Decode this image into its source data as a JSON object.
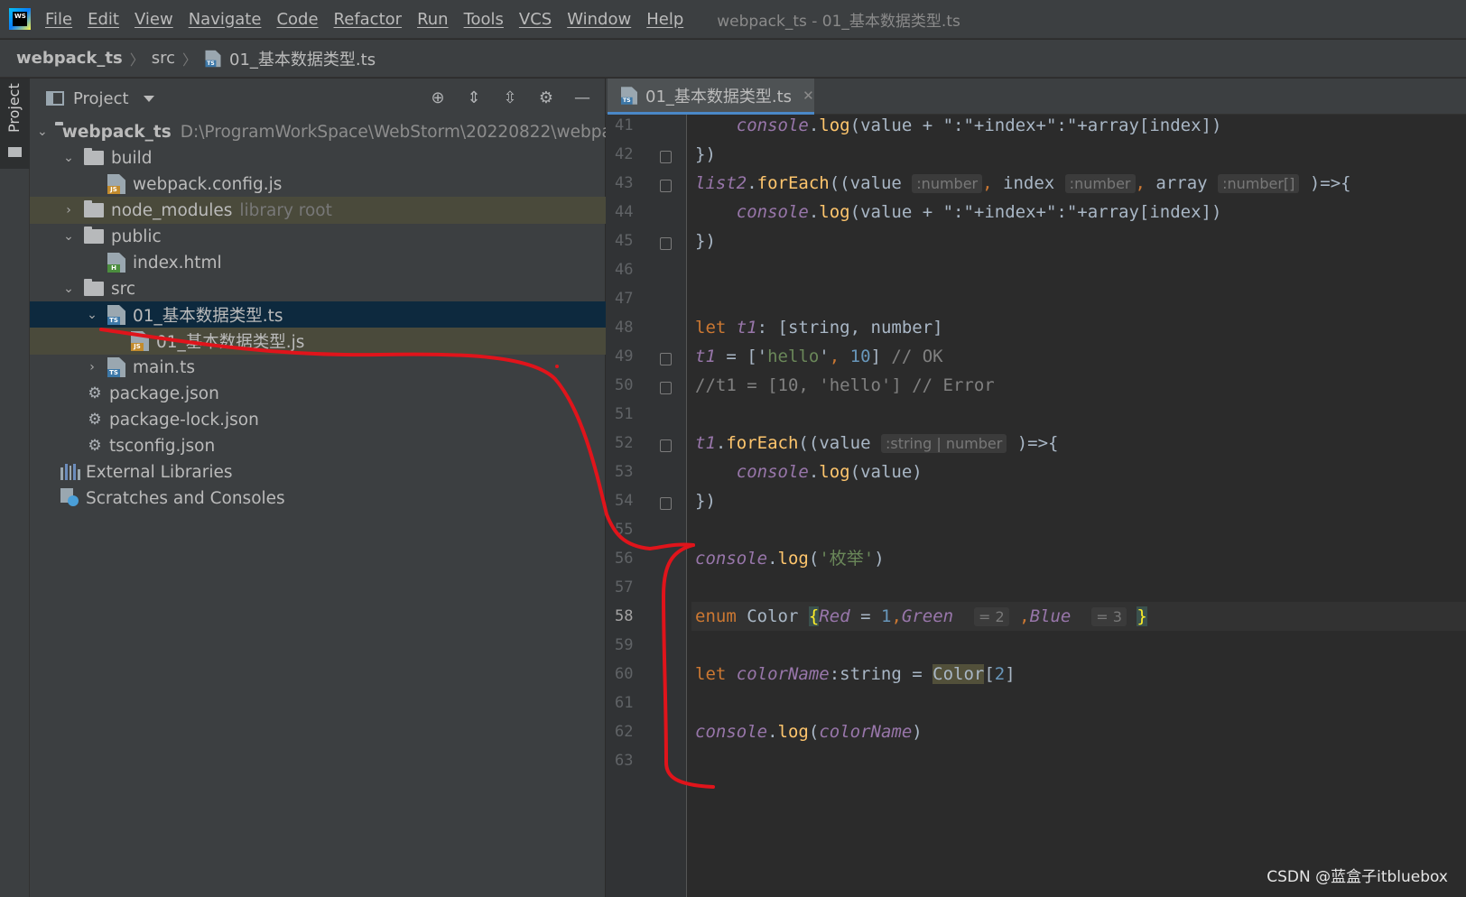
{
  "menubar": {
    "items": [
      "File",
      "Edit",
      "View",
      "Navigate",
      "Code",
      "Refactor",
      "Run",
      "Tools",
      "VCS",
      "Window",
      "Help"
    ],
    "window_title": "webpack_ts - 01_基本数据类型.ts"
  },
  "breadcrumb": {
    "project": "webpack_ts",
    "folder": "src",
    "file": "01_基本数据类型.ts"
  },
  "toolstrip": {
    "label": "Project"
  },
  "project_panel": {
    "title": "Project",
    "tree": {
      "root": "webpack_ts",
      "root_path": "D:\\ProgramWorkSpace\\WebStorm\\20220822\\webpac",
      "build": "build",
      "webpack_config": "webpack.config.js",
      "node_modules": "node_modules",
      "node_modules_note": "library root",
      "public": "public",
      "index_html": "index.html",
      "src": "src",
      "basic_ts": "01_基本数据类型.ts",
      "basic_js": "01_基本数据类型.js",
      "main_ts": "main.ts",
      "package_json": "package.json",
      "package_lock": "package-lock.json",
      "tsconfig": "tsconfig.json",
      "external_libraries": "External Libraries",
      "scratches": "Scratches and Consoles"
    }
  },
  "editor": {
    "tab_label": "01_基本数据类型.ts",
    "line_numbers": [
      "41",
      "42",
      "43",
      "44",
      "45",
      "46",
      "47",
      "48",
      "49",
      "50",
      "51",
      "52",
      "53",
      "54",
      "55",
      "56",
      "57",
      "58",
      "59",
      "60",
      "61",
      "62",
      "63"
    ],
    "current_line": "58",
    "tokens": {
      "console": "console",
      "log": "log",
      "forEach": "forEach",
      "list2": "list2",
      "value": "value",
      "index": "index",
      "array": "array",
      "index_expr": "(value + \":\"+index+\":\"+array[index])",
      "close_brace": "})",
      "hint_number": ":number",
      "hint_number_arr": ":number[]",
      "hint_string_number": ":string | number",
      "let": "let",
      "t1": "t1",
      "tuple_type": ": [string, number]",
      "t1_assign_open": " = ['",
      "hello": "hello",
      "ten": "10",
      "comment_ok": "// OK",
      "comment_error": "//t1 = [10, 'hello'] // Error",
      "log_value": "(value)",
      "enum_str": "枚举",
      "enum": "enum",
      "color_type": "Color",
      "red": "Red",
      "one": "1",
      "green": "Green",
      "hint_eq2": "= 2",
      "blue": "Blue",
      "hint_eq3": "= 3",
      "colorName": "colorName",
      "string_type": ":string",
      "two": "2"
    }
  },
  "watermark": "CSDN @蓝盒子itbluebox",
  "colors": {
    "keyword": "#cc7832",
    "function": "#ffc66d",
    "global": "#9876aa",
    "string": "#6a8759",
    "number": "#6897bb",
    "comment": "#808080",
    "selection": "#0d293e",
    "annotation": "#e0141b"
  }
}
